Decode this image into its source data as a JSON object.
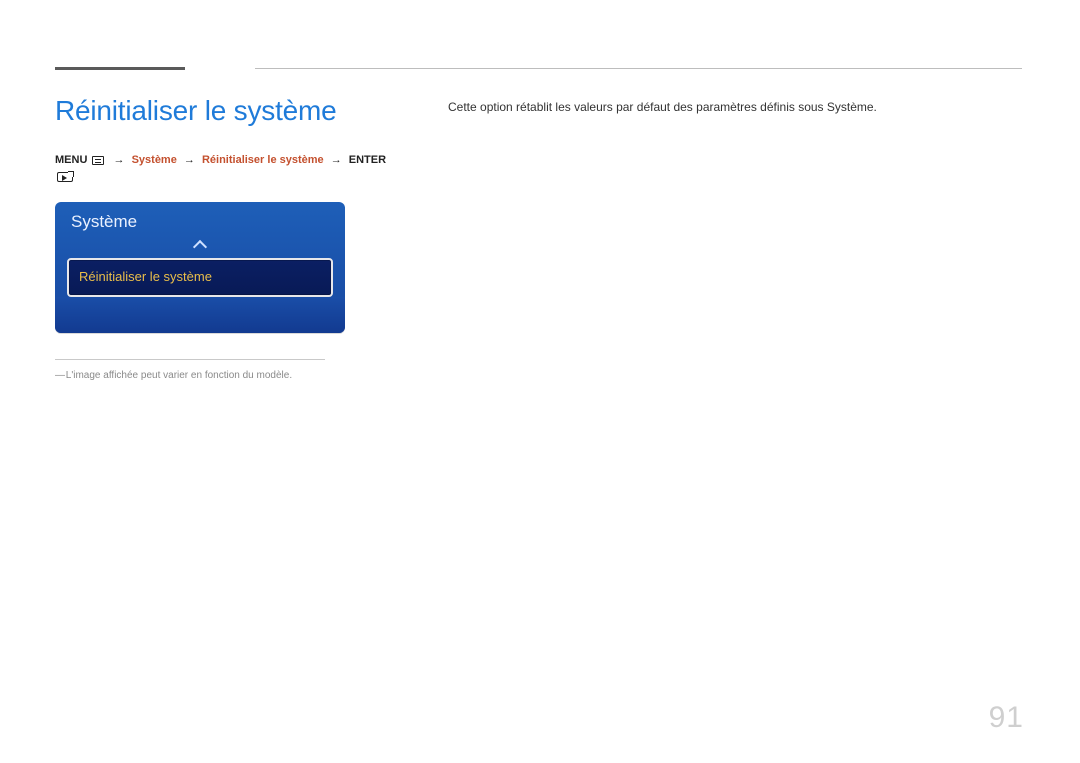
{
  "page_number": "91",
  "heading": "Réinitialiser le système",
  "breadcrumb": {
    "menu_label": "MENU",
    "arrow": "→",
    "path1": "Système",
    "path2": "Réinitialiser le système",
    "enter_label": "ENTER"
  },
  "panel": {
    "title": "Système",
    "selected_item": "Réinitialiser le système"
  },
  "footnote": {
    "dash": "―",
    "text": "L'image affichée peut varier en fonction du modèle."
  },
  "body": {
    "paragraph": "Cette option rétablit les valeurs par défaut des paramètres définis sous Système."
  }
}
